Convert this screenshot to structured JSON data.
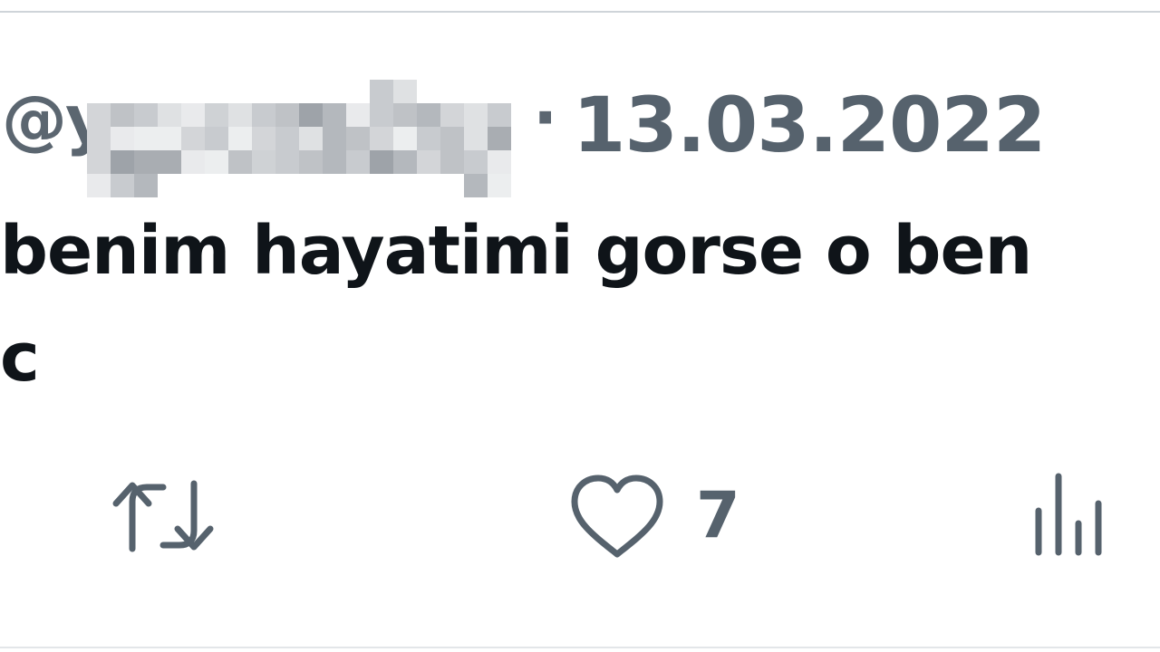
{
  "tweet": {
    "handle_prefix": "@y",
    "separator": "·",
    "date": "13.03.2022",
    "text_line1": "benim hayatimi gorse o ben",
    "text_line2": "c"
  },
  "actions": {
    "retweet_icon": "retweet-icon",
    "like_icon": "heart-icon",
    "like_count": "7",
    "views_icon": "views-bar-chart-icon"
  },
  "colors": {
    "text": "#0f1419",
    "secondary": "#56626d",
    "border": "#cfd4d9"
  }
}
